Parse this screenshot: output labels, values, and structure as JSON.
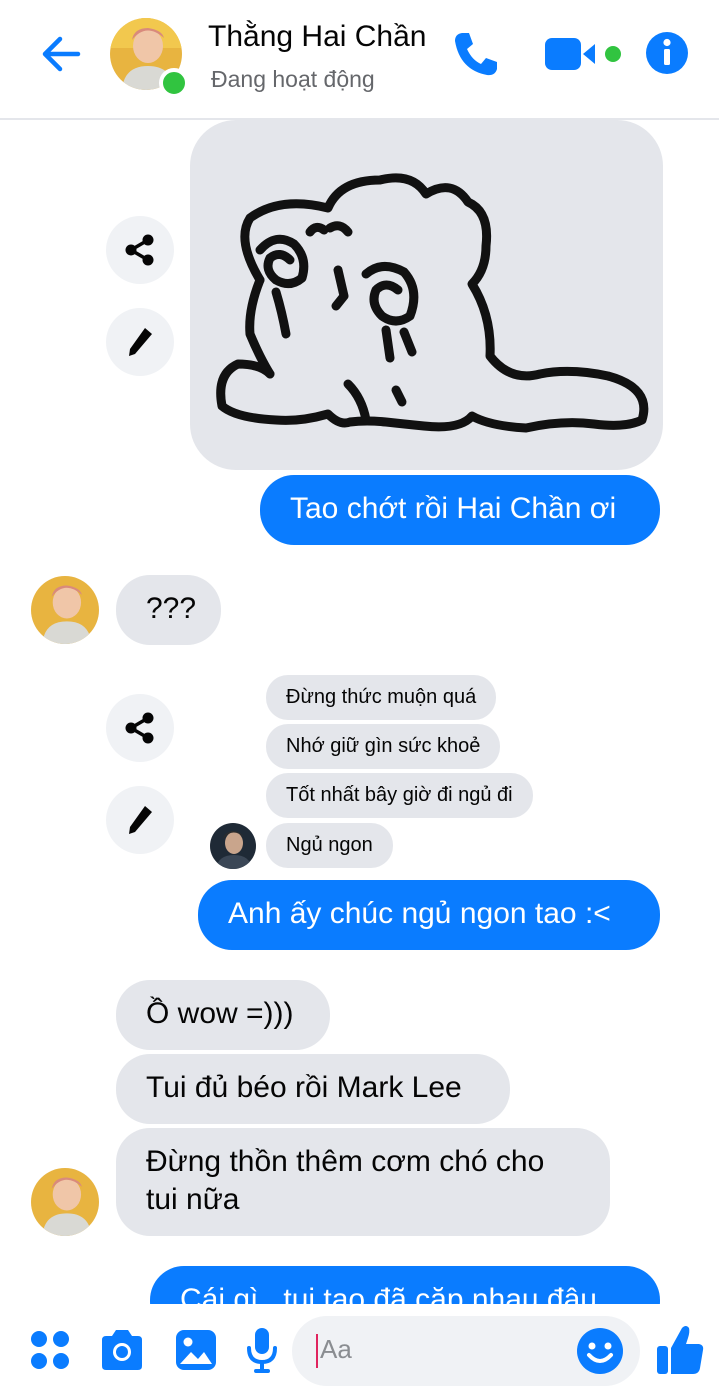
{
  "header": {
    "contact_name": "Thằng Hai Chần",
    "status": "Đang hoạt động"
  },
  "colors": {
    "accent": "#0a7cff",
    "online": "#31c440",
    "bubble_in": "#e4e6eb"
  },
  "messages": {
    "m1": "Tao chớt rồi Hai Chần ơi",
    "m2": "???",
    "shared": [
      "Đừng thức muộn quá",
      "Nhớ giữ gìn sức khoẻ",
      "Tốt nhất bây giờ đi ngủ đi",
      "Ngủ ngon"
    ],
    "m3": "Anh ấy chúc ngủ ngon tao :<",
    "m4": "Ồ wow =)))",
    "m5": "Tui đủ béo rồi Mark Lee",
    "m6": "Đừng thồn thêm cơm chó cho tui nữa",
    "m7_partial": "Cái gì , tui tao đã cặp nhau đâu"
  },
  "composer": {
    "placeholder": "Aa"
  },
  "icons": [
    "back-arrow-icon",
    "phone-icon",
    "video-call-icon",
    "info-icon",
    "share-icon",
    "edit-pencil-icon",
    "apps-grid-icon",
    "camera-icon",
    "gallery-icon",
    "microphone-icon",
    "emoji-icon",
    "like-thumb-icon"
  ]
}
